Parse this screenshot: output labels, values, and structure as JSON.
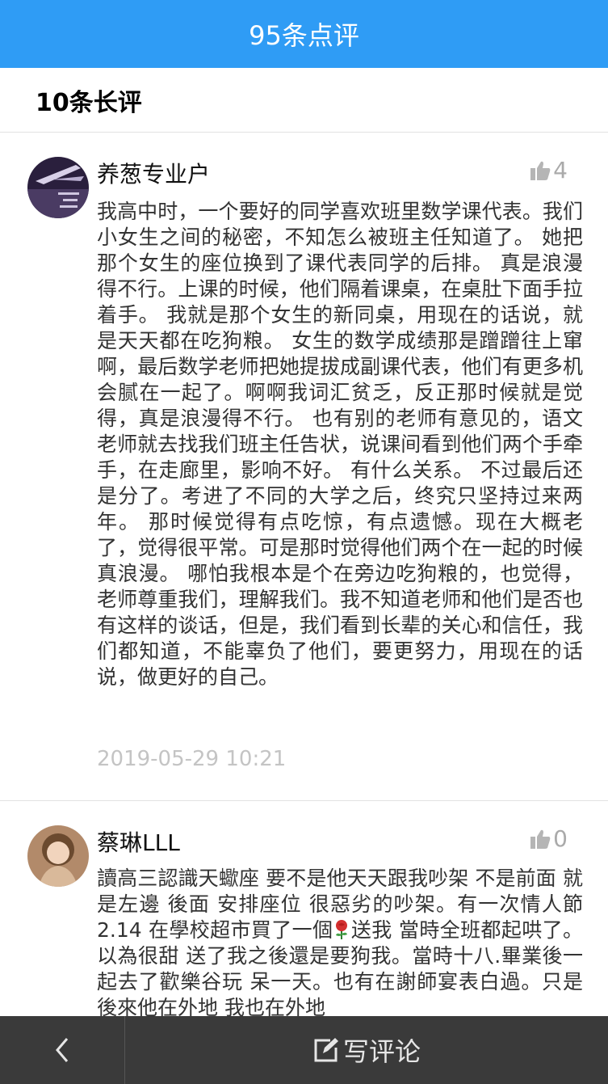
{
  "header": {
    "title": "95条点评"
  },
  "section": {
    "title": "10条长评"
  },
  "reviews": [
    {
      "username": "养葱专业户",
      "likes": "4",
      "body": "我高中时，一个要好的同学喜欢班里数学课代表。我们小女生之间的秘密，不知怎么被班主任知道了。 她把那个女生的座位换到了课代表同学的后排。 真是浪漫得不行。上课的时候，他们隔着课桌，在桌肚下面手拉着手。 我就是那个女生的新同桌，用现在的话说，就是天天都在吃狗粮。 女生的数学成绩那是蹭蹭往上窜啊，最后数学老师把她提拔成副课代表，他们有更多机会腻在一起了。啊啊我词汇贫乏，反正那时候就是觉得，真是浪漫得不行。 也有别的老师有意见的，语文老师就去找我们班主任告状，说课间看到他们两个手牵手，在走廊里，影响不好。 有什么关系。 不过最后还是分了。考进了不同的大学之后，终究只坚持过来两年。 那时候觉得有点吃惊，有点遗憾。现在大概老了，觉得很平常。可是那时觉得他们两个在一起的时候真浪漫。 哪怕我根本是个在旁边吃狗粮的，也觉得，老师尊重我们，理解我们。我不知道老师和他们是否也有这样的谈话，但是，我们看到长辈的关心和信任，我们都知道，不能辜负了他们，要更努力，用现在的话说，做更好的自己。",
      "time": "2019-05-29 10:21"
    },
    {
      "username": "蔡琳LLL",
      "likes": "0",
      "body_before": "讀高三認識天蠍座 要不是他天天跟我吵架 不是前面 就是左邊 後面 安排座位 很惡劣的吵架。有一次情人節2.14 在學校超市買了一個",
      "body_after": "送我 當時全班都起哄了。以為很甜 送了我之後還是要狗我。當時十八.畢業後一起去了歡樂谷玩 呆一天。也有在謝師宴表白過。只是後來他在外地 我也在外地"
    }
  ],
  "footer": {
    "write_label": "写评论"
  },
  "icons": {
    "like": "thumbs-up-icon",
    "back": "chevron-left-icon",
    "write": "edit-icon",
    "flower": "rose-emoji-icon"
  },
  "colors": {
    "header_bg": "#2f9cf5",
    "footer_bg": "#3a3a3a",
    "time": "#c4c4c4",
    "likes": "#aaaaaa"
  }
}
